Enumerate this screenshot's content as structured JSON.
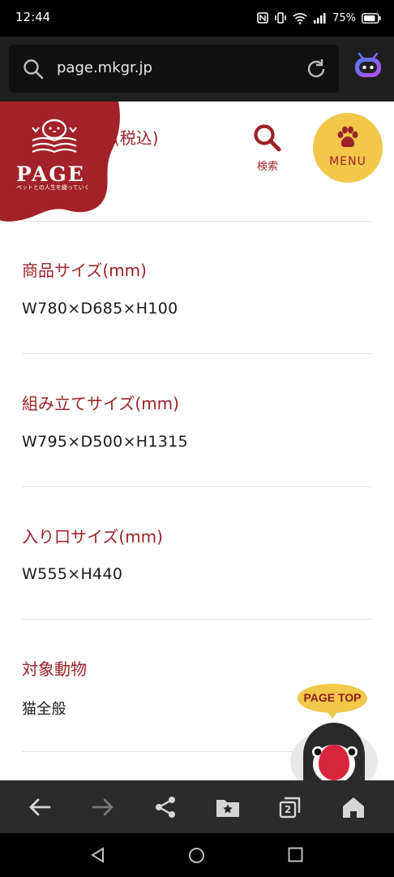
{
  "status_bar": {
    "time": "12:44",
    "battery": "75%"
  },
  "browser": {
    "url": "page.mkgr.jp",
    "tab_count": "2"
  },
  "site": {
    "logo": {
      "name": "PAGE",
      "tagline": "ペットとの人生を綴っていく"
    },
    "search_label": "検索",
    "menu_label": "MENU",
    "partial_heading": "格(税込)",
    "specs": [
      {
        "label": "商品サイズ(mm)",
        "value": "W780×D685×H100"
      },
      {
        "label": "組み立てサイズ(mm)",
        "value": "W795×D500×H1315"
      },
      {
        "label": "入り口サイズ(mm)",
        "value": "W555×H440"
      },
      {
        "label": "対象動物",
        "value": "猫全般"
      }
    ],
    "page_top_label": "PAGE TOP"
  },
  "colors": {
    "brand_red": "#9b2228",
    "menu_yellow": "#f2c74a"
  }
}
